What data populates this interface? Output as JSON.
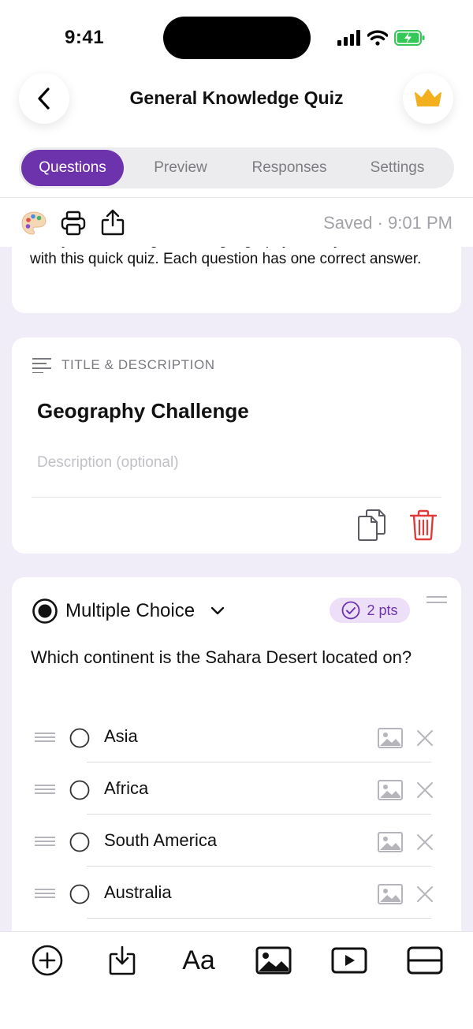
{
  "status": {
    "time": "9:41"
  },
  "nav": {
    "title": "General Knowledge Quiz"
  },
  "tabs": [
    {
      "label": "Questions",
      "active": true
    },
    {
      "label": "Preview",
      "active": false
    },
    {
      "label": "Responses",
      "active": false
    },
    {
      "label": "Settings",
      "active": false
    }
  ],
  "toolbar": {
    "saved_text": "Saved · 9:01 PM"
  },
  "intro": {
    "description": "Test your knowledge across geography, history, and science with this quick quiz. Each question has one correct answer."
  },
  "section_card": {
    "label": "TITLE & DESCRIPTION",
    "title": "Geography Challenge",
    "description_placeholder": "Description (optional)"
  },
  "question_card": {
    "type_label": "Multiple Choice",
    "points_label": "2 pts",
    "question": "Which continent is the Sahara Desert located on?",
    "options": [
      "Asia",
      "Africa",
      "South America",
      "Australia"
    ]
  },
  "bottom_tools": {
    "text_tool_label": "Aa"
  },
  "colors": {
    "accent": "#6d33ad",
    "background": "#f0ecf8",
    "delete": "#e03b3b",
    "crown": "#f2b01e",
    "battery": "#36c759"
  }
}
